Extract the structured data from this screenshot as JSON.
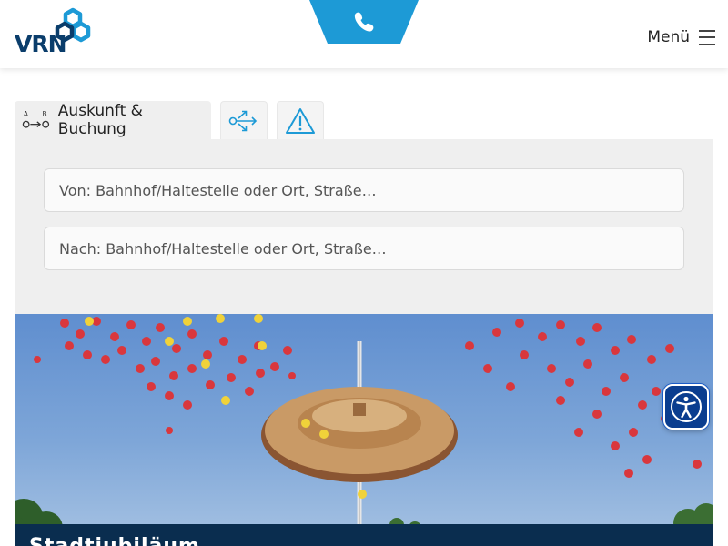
{
  "header": {
    "logo_text": "VRN",
    "logo_icon": "vrn-logo-icon",
    "phone_icon": "phone-icon",
    "menu_label": "Menü",
    "menu_icon": "hamburger-icon"
  },
  "tabs": [
    {
      "label": "Auskunft & Buchung",
      "icon": "route-a-to-b-icon",
      "active": true
    },
    {
      "label": "",
      "icon": "share-connections-icon",
      "active": false
    },
    {
      "label": "",
      "icon": "warning-icon",
      "active": false
    }
  ],
  "search": {
    "from_placeholder": "Von: Bahnhof/Haltestelle oder Ort, Straße…",
    "to_placeholder": "Nach: Bahnhof/Haltestelle oder Ort, Straße…"
  },
  "hero": {
    "caption": "Stadtjubiläum..."
  },
  "accessibility": {
    "icon": "accessibility-person-icon"
  },
  "colors": {
    "brand_blue": "#0a3d6b",
    "accent_blue": "#1d9ad6",
    "panel_gray": "#efefef",
    "caption_bg": "#0a2d4f"
  }
}
